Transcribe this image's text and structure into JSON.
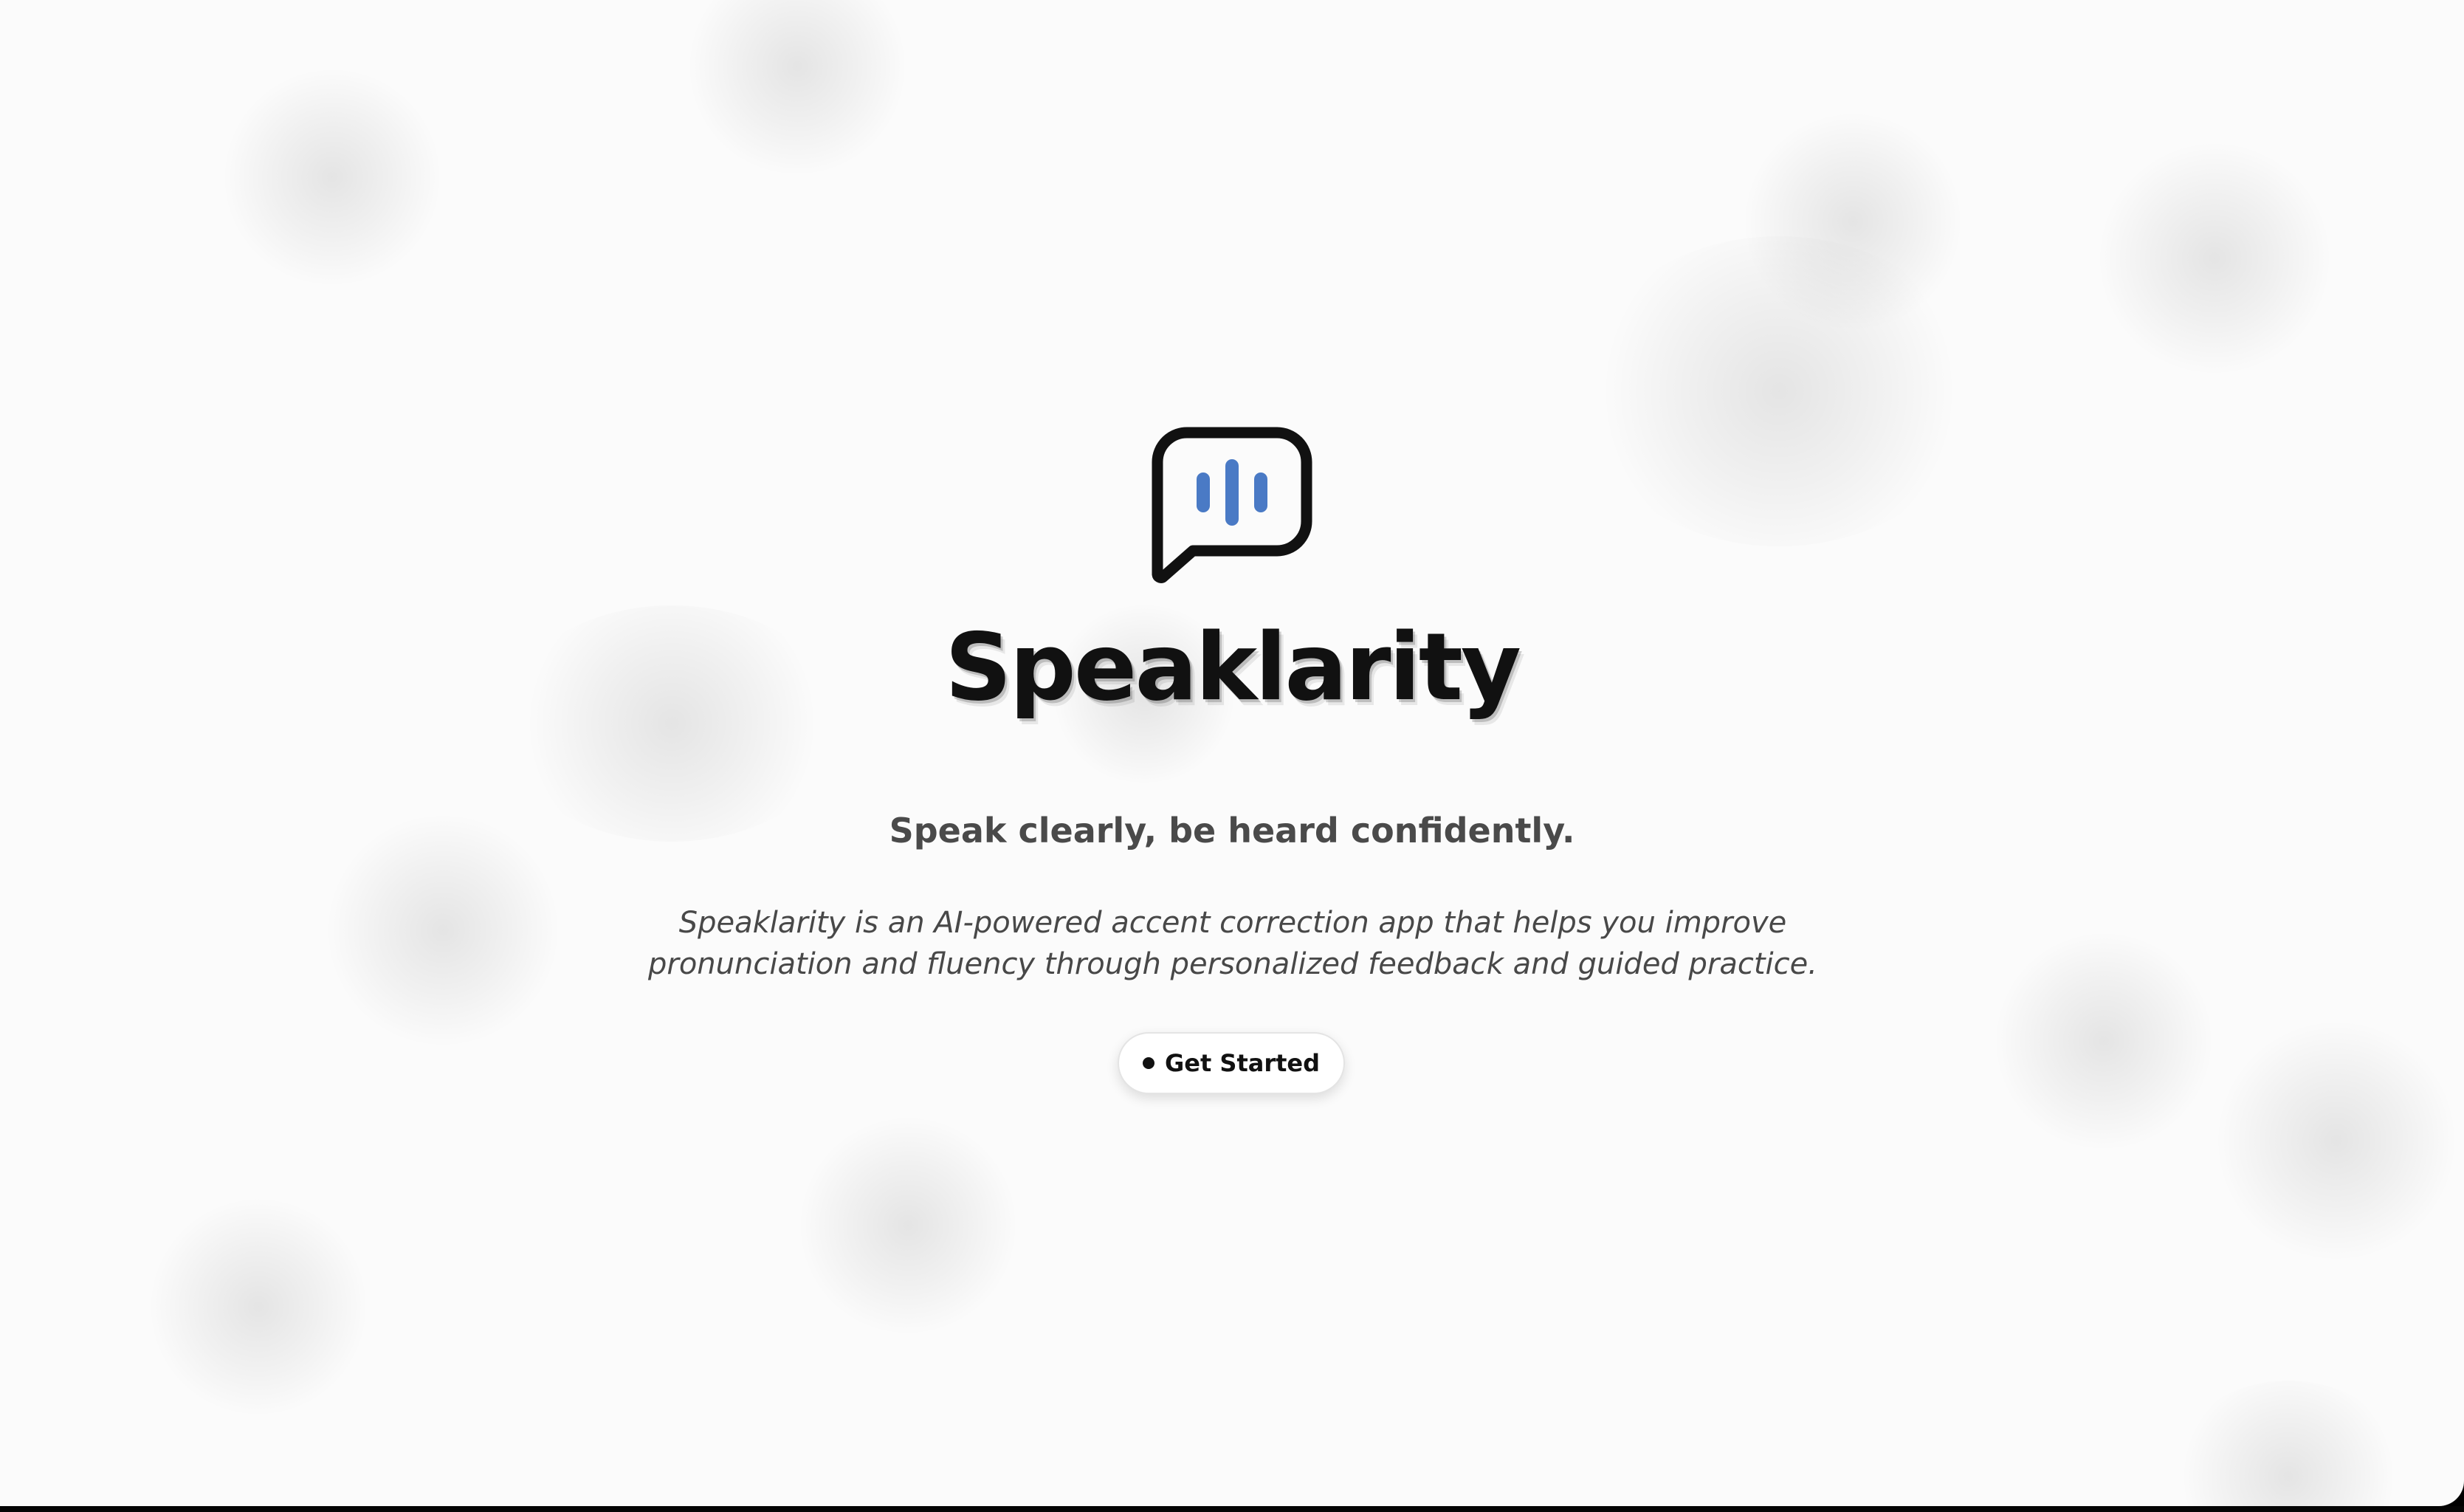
{
  "app": {
    "logo_icon": "speech-bubble-soundwave-icon",
    "title": "Speaklarity",
    "tagline": "Speak clearly, be heard confidently.",
    "description": "Speaklarity is an AI-powered accent correction app that helps you improve pronunciation and fluency through personalized feedback and guided practice.",
    "cta": {
      "label": "Get Started",
      "icon": "dot-icon"
    }
  },
  "colors": {
    "background": "#fbfbfb",
    "text_primary": "#111111",
    "text_secondary": "#4a4a4a",
    "accent_blue": "#4a7ac5",
    "button_background": "#ffffff"
  }
}
